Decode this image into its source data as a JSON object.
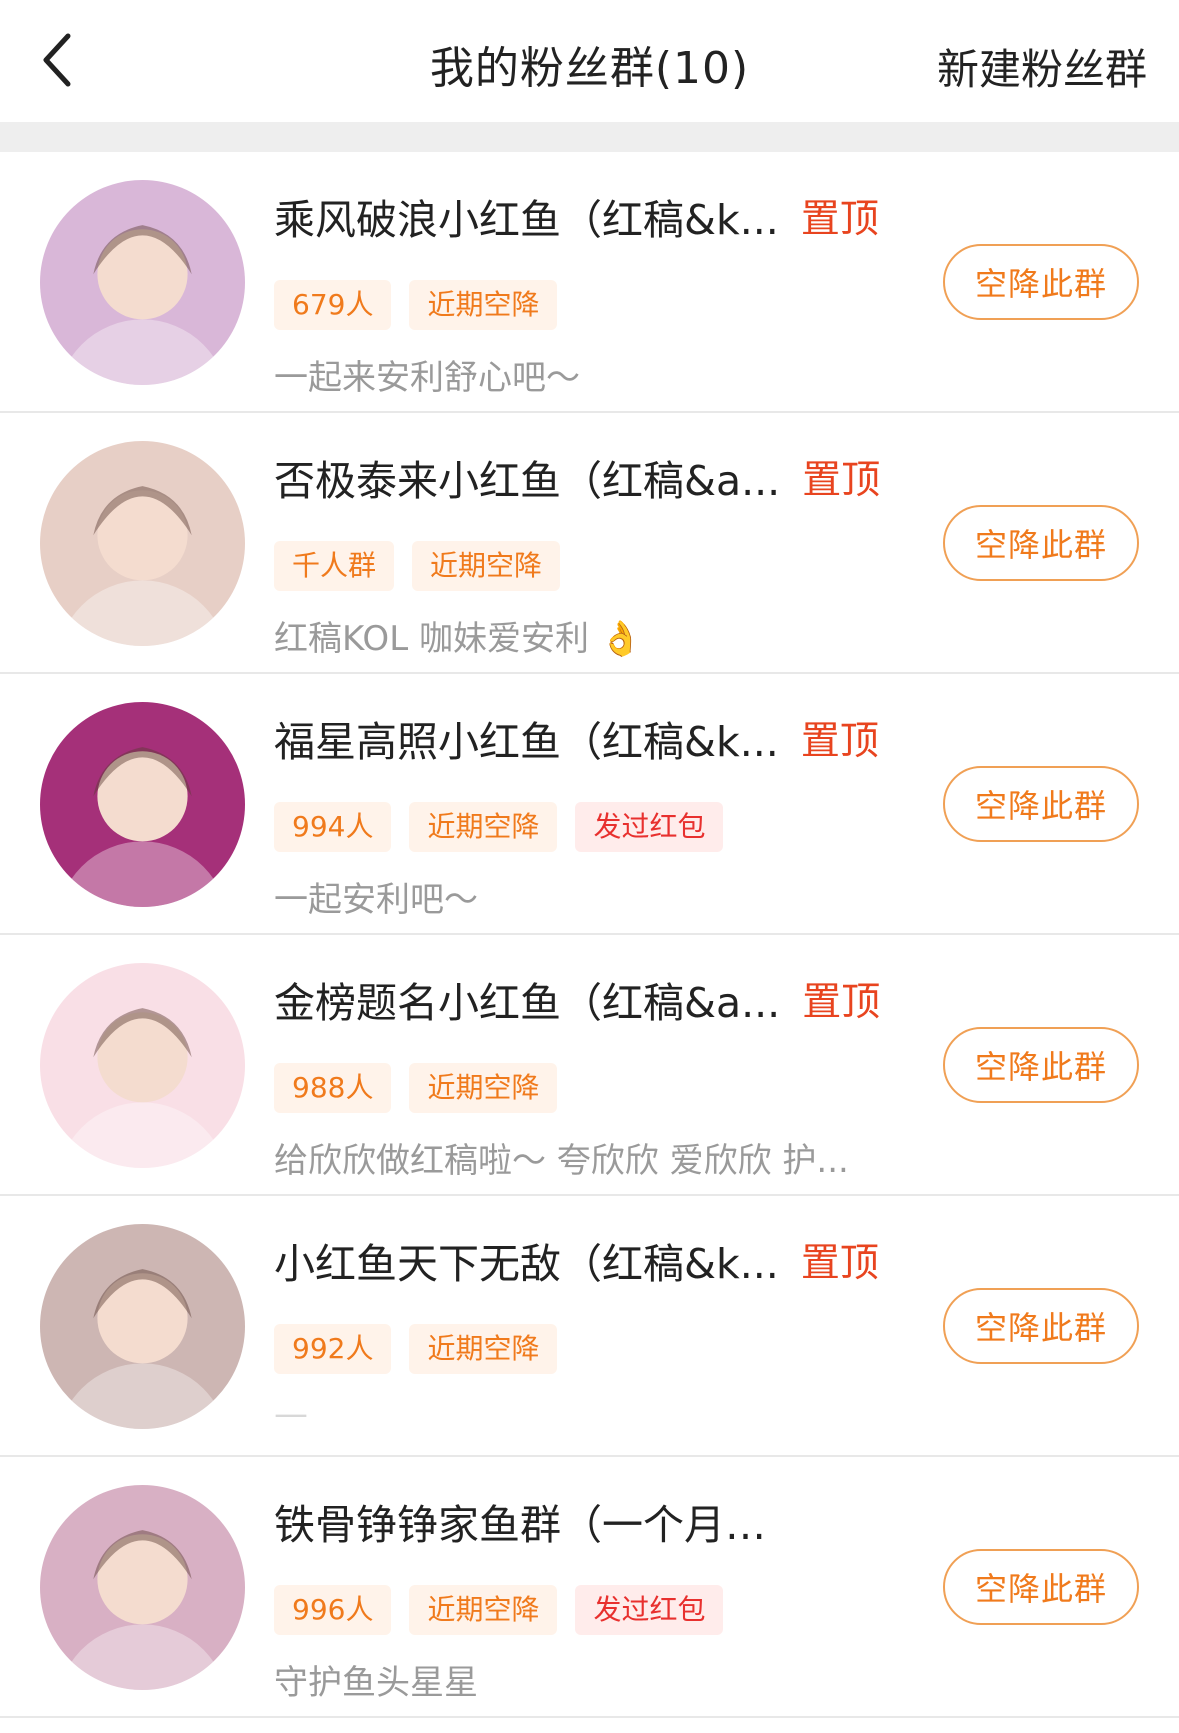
{
  "header": {
    "title": "我的粉丝群(10)",
    "new_group_label": "新建粉丝群",
    "back_icon": "chevron-left-icon"
  },
  "groups": [
    {
      "name": "乘风破浪小红鱼（红稿&k...",
      "pin_label": "置顶",
      "tags": [
        {
          "text": "679人",
          "kind": "orange"
        },
        {
          "text": "近期空降",
          "kind": "orange"
        }
      ],
      "desc": "一起来安利舒心吧～",
      "button": "空降此群",
      "avatar_color": "#d9b7d8"
    },
    {
      "name": "否极泰来小红鱼（红稿&a...",
      "pin_label": "置顶",
      "tags": [
        {
          "text": "千人群",
          "kind": "orange"
        },
        {
          "text": "近期空降",
          "kind": "orange"
        }
      ],
      "desc": "红稿KOL 咖妹爱安利 👌",
      "button": "空降此群",
      "avatar_color": "#e7cfc6"
    },
    {
      "name": "福星高照小红鱼（红稿&k...",
      "pin_label": "置顶",
      "tags": [
        {
          "text": "994人",
          "kind": "orange"
        },
        {
          "text": "近期空降",
          "kind": "orange"
        },
        {
          "text": "发过红包",
          "kind": "red"
        }
      ],
      "desc": "一起安利吧～",
      "button": "空降此群",
      "avatar_color": "#a53079"
    },
    {
      "name": "金榜题名小红鱼（红稿&a...",
      "pin_label": "置顶",
      "tags": [
        {
          "text": "988人",
          "kind": "orange"
        },
        {
          "text": "近期空降",
          "kind": "orange"
        }
      ],
      "desc": "给欣欣做红稿啦～ 夸欣欣 爱欣欣 护...",
      "button": "空降此群",
      "avatar_color": "#f9dfe6"
    },
    {
      "name": "小红鱼天下无敌（红稿&k...",
      "pin_label": "置顶",
      "tags": [
        {
          "text": "992人",
          "kind": "orange"
        },
        {
          "text": "近期空降",
          "kind": "orange"
        }
      ],
      "desc": "—",
      "button": "空降此群",
      "avatar_color": "#cdb6b3"
    },
    {
      "name": "铁骨铮铮家鱼群（一个月不发...",
      "pin_label": "",
      "tags": [
        {
          "text": "996人",
          "kind": "orange"
        },
        {
          "text": "近期空降",
          "kind": "orange"
        },
        {
          "text": "发过红包",
          "kind": "red"
        }
      ],
      "desc": "守护鱼头星星",
      "button": "空降此群",
      "avatar_color": "#d8b0c4"
    }
  ]
}
